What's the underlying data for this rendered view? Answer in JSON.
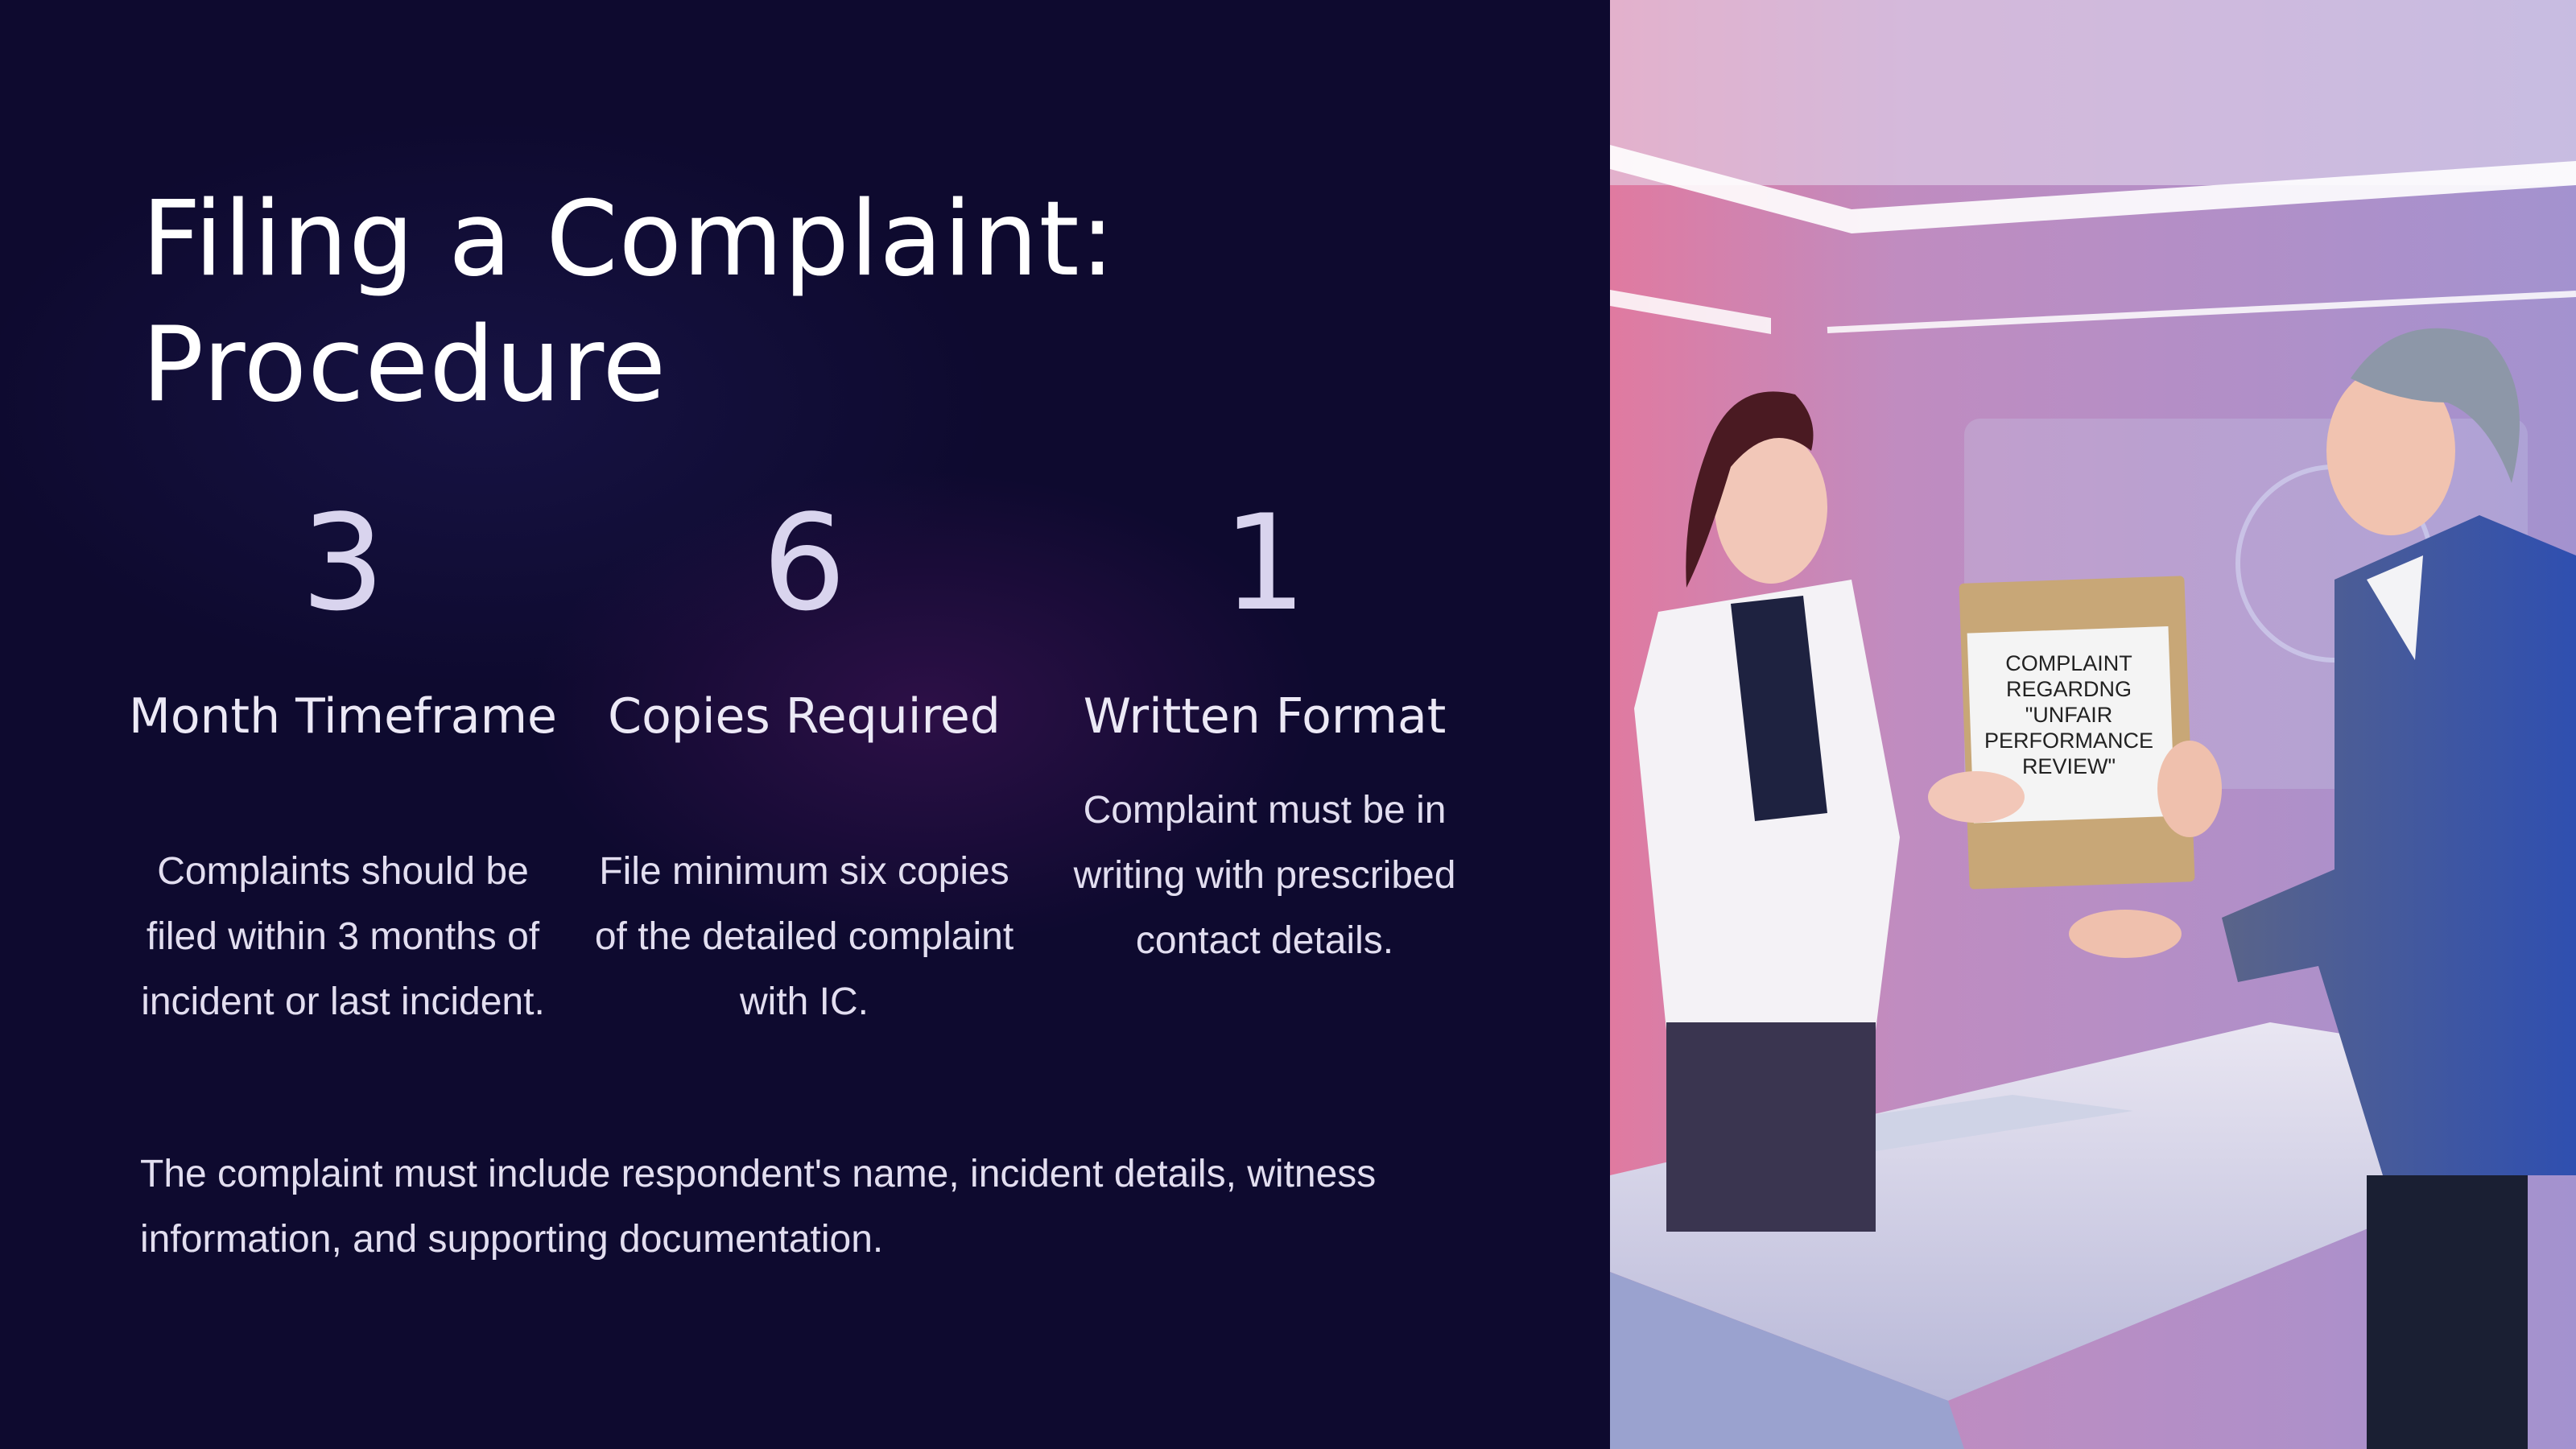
{
  "slide": {
    "title_line1": "Filing a Complaint:",
    "title_line2": "Procedure"
  },
  "stats": [
    {
      "value": "3",
      "label": "Month Timeframe",
      "description": "Complaints should be filed within 3 months of incident or last incident."
    },
    {
      "value": "6",
      "label": "Copies Required",
      "description": "File minimum six copies of the detailed complaint with IC."
    },
    {
      "value": "1",
      "label": "Written Format",
      "description": "Complaint must be in writing with prescribed contact details."
    }
  ],
  "footer": {
    "text": "The complaint must include respondent's name, incident details, witness information, and supporting documentation."
  },
  "photo": {
    "document_label": "COMPLAINT REGARDNG \"UNFAIR PERFORMANCE REVIEW\""
  },
  "colors": {
    "background": "#0e0a2f",
    "heading": "#ffffff",
    "stat_value": "#d9d4ee",
    "body_text": "#e2def0",
    "photo_accent_pink": "#d9799f",
    "photo_accent_blue": "#3f66d8"
  }
}
